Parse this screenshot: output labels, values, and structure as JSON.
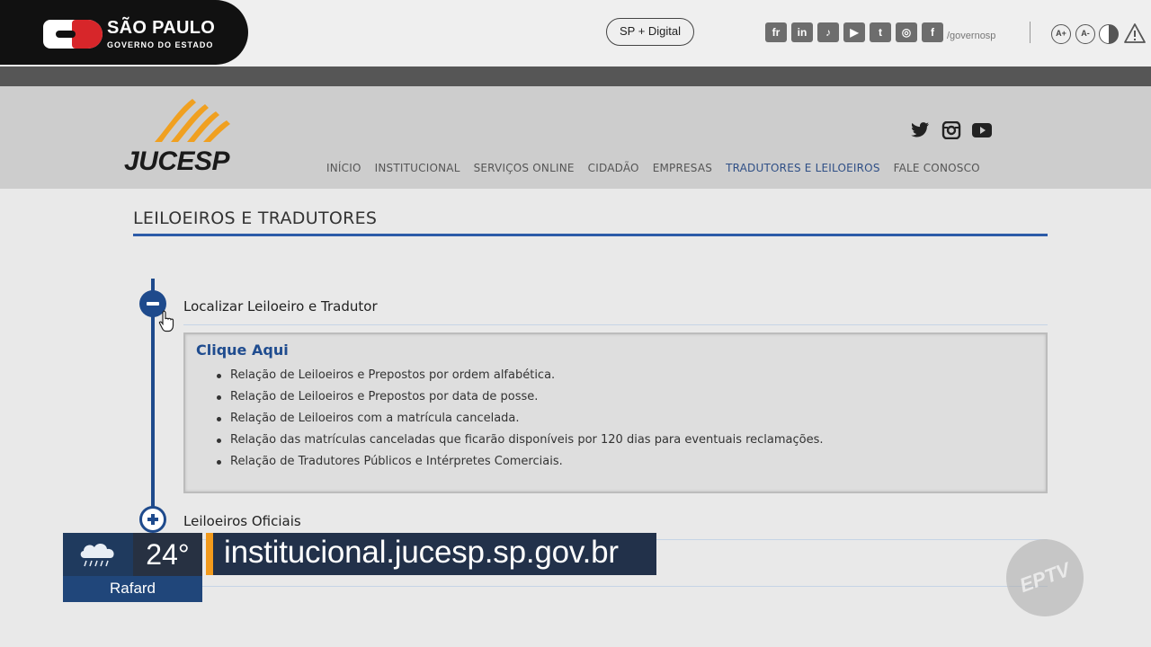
{
  "gov_bar": {
    "title": "SÃO PAULO",
    "subtitle": "GOVERNO DO ESTADO",
    "sp_digital": "SP + Digital",
    "social_icons": [
      "flickr-icon",
      "linkedin-icon",
      "tiktok-icon",
      "youtube-icon",
      "twitter-icon",
      "instagram-icon",
      "facebook-icon"
    ],
    "social_glyphs": [
      "fr",
      "in",
      "♪",
      "▶",
      "t",
      "◎",
      "f"
    ],
    "handle": "/governosp",
    "accessibility": {
      "increase": "A+",
      "decrease": "A-"
    }
  },
  "site": {
    "logo_text": "JUCESP",
    "social_icons": [
      "twitter-icon",
      "instagram-icon",
      "youtube-icon"
    ],
    "nav": [
      {
        "label": "INÍCIO",
        "active": false
      },
      {
        "label": "INSTITUCIONAL",
        "active": false
      },
      {
        "label": "SERVIÇOS ONLINE",
        "active": false
      },
      {
        "label": "CIDADÃO",
        "active": false
      },
      {
        "label": "EMPRESAS",
        "active": false
      },
      {
        "label": "TRADUTORES E LEILOEIROS",
        "active": true
      },
      {
        "label": "FALE CONOSCO",
        "active": false
      }
    ]
  },
  "content": {
    "page_title": "LEILOEIROS E TRADUTORES",
    "accordion": [
      {
        "title": "Localizar Leiloeiro e Tradutor",
        "expanded": true,
        "link_heading": "Clique Aqui",
        "links": [
          "Relação de Leiloeiros e Prepostos por ordem alfabética.",
          "Relação de Leiloeiros e Prepostos por data de posse.",
          "Relação de Leiloeiros com a matrícula cancelada.",
          "Relação das matrículas canceladas que ficarão disponíveis por 120 dias para eventuais reclamações.",
          "Relação de Tradutores Públicos e Intérpretes Comerciais."
        ]
      },
      {
        "title": "Leiloeiros Oficiais",
        "expanded": false
      }
    ]
  },
  "overlay": {
    "weather": {
      "temperature": "24°",
      "city": "Rafard",
      "icon": "rain-cloud-icon"
    },
    "url": "institucional.jucesp.sp.gov.br",
    "channel": "EPTV"
  },
  "colors": {
    "accent_blue": "#1e4a8c",
    "active_nav": "#2f4f86",
    "logo_orange": "#f0a020",
    "sp_red": "#d7262a",
    "overlay_orange": "#f29a1c"
  }
}
